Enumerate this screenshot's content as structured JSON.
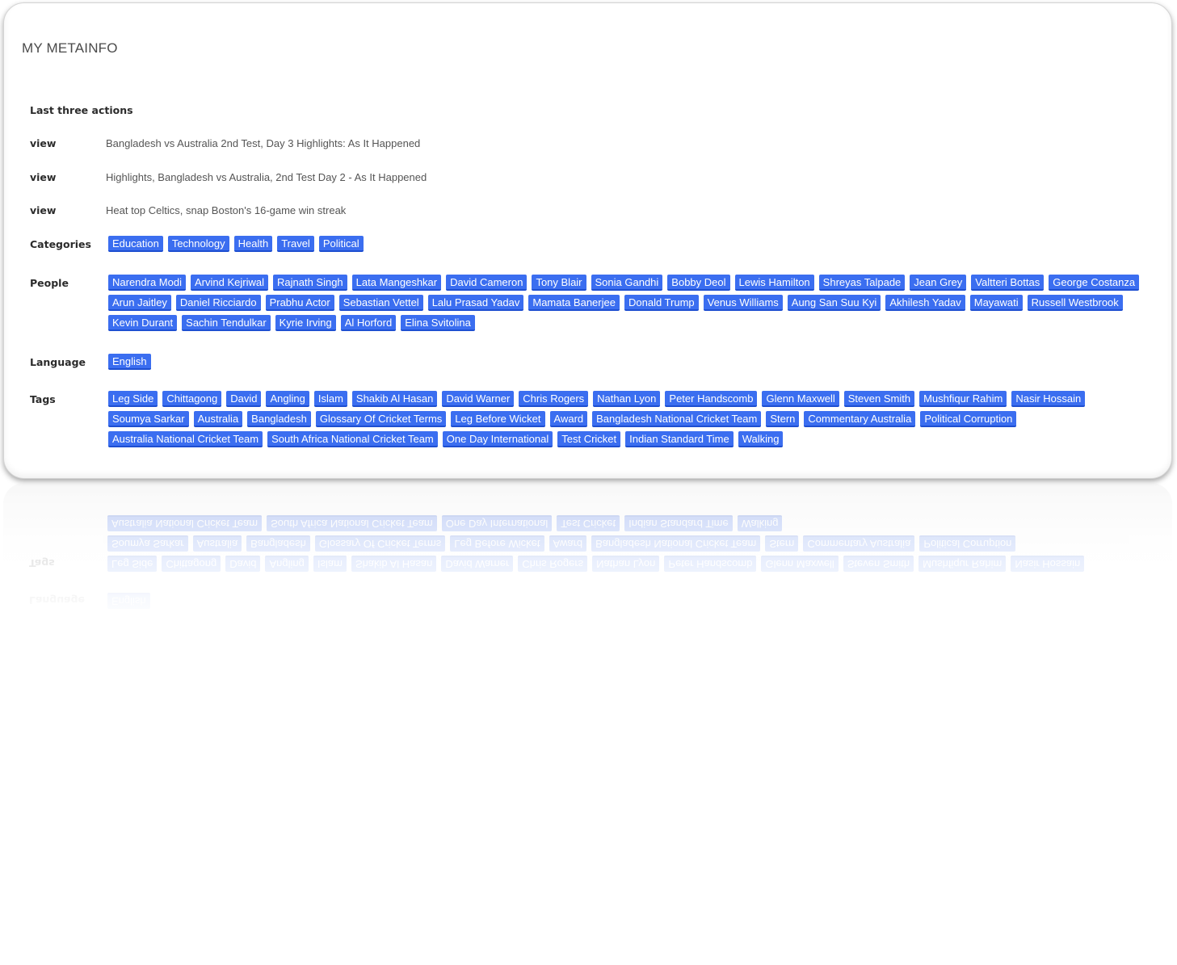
{
  "title": "MY METAINFO",
  "accent_color": "#3b6ef0",
  "last_actions": {
    "label": "Last three actions",
    "items": [
      {
        "type": "view",
        "text": "Bangladesh vs Australia 2nd Test, Day 3 Highlights: As It Happened"
      },
      {
        "type": "view",
        "text": "Highlights, Bangladesh vs Australia, 2nd Test Day 2 - As It Happened"
      },
      {
        "type": "view",
        "text": "Heat top Celtics, snap Boston's 16-game win streak"
      }
    ]
  },
  "categories": {
    "label": "Categories",
    "items": [
      "Education",
      "Technology",
      "Health",
      "Travel",
      "Political"
    ]
  },
  "people": {
    "label": "People",
    "items": [
      "Narendra Modi",
      "Arvind Kejriwal",
      "Rajnath Singh",
      "Lata Mangeshkar",
      "David Cameron",
      "Tony Blair",
      "Sonia Gandhi",
      "Bobby Deol",
      "Lewis Hamilton",
      "Shreyas Talpade",
      "Jean Grey",
      "Valtteri Bottas",
      "George Costanza",
      "Arun Jaitley",
      "Daniel Ricciardo",
      "Prabhu Actor",
      "Sebastian Vettel",
      "Lalu Prasad Yadav",
      "Mamata Banerjee",
      "Donald Trump",
      "Venus Williams",
      "Aung San Suu Kyi",
      "Akhilesh Yadav",
      "Mayawati",
      "Russell Westbrook",
      "Kevin Durant",
      "Sachin Tendulkar",
      "Kyrie Irving",
      "Al Horford",
      "Elina Svitolina"
    ]
  },
  "language": {
    "label": "Language",
    "items": [
      "English"
    ]
  },
  "tags": {
    "label": "Tags",
    "items": [
      "Leg Side",
      "Chittagong",
      "David",
      "Angling",
      "Islam",
      "Shakib Al Hasan",
      "David Warner",
      "Chris Rogers",
      "Nathan Lyon",
      "Peter Handscomb",
      "Glenn Maxwell",
      "Steven Smith",
      "Mushfiqur Rahim",
      "Nasir Hossain",
      "Soumya Sarkar",
      "Australia",
      "Bangladesh",
      "Glossary Of Cricket Terms",
      "Leg Before Wicket",
      "Award",
      "Bangladesh National Cricket Team",
      "Stern",
      "Commentary Australia",
      "Political Corruption",
      "Australia National Cricket Team",
      "South Africa National Cricket Team",
      "One Day International",
      "Test Cricket",
      "Indian Standard Time",
      "Walking"
    ]
  }
}
